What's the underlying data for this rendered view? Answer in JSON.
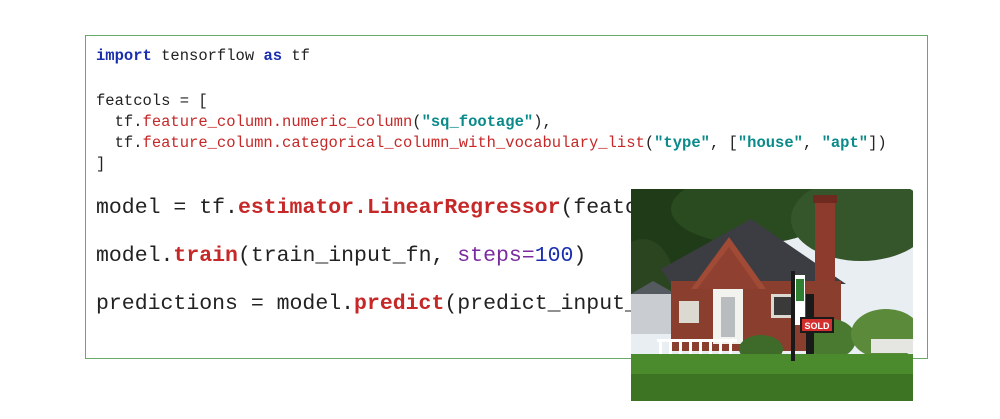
{
  "code": {
    "line1": {
      "kw_import": "import",
      "module": " tensorflow ",
      "kw_as": "as",
      "alias": " tf"
    },
    "line2": {
      "text": "featcols = ["
    },
    "line3": {
      "prefix": "  tf.",
      "fn": "feature_column.numeric_column",
      "open": "(",
      "str": "\"sq_footage\"",
      "close": "),"
    },
    "line4": {
      "prefix": "  tf.",
      "fn": "feature_column.categorical_column_with_vocabulary_list",
      "open": "(",
      "str1": "\"type\"",
      "sep1": ", [",
      "str2": "\"house\"",
      "sep2": ", ",
      "str3": "\"apt\"",
      "close": "])"
    },
    "line5": {
      "text": "]"
    },
    "line6": {
      "prefix": "model = tf.",
      "fn": "estimator.LinearRegressor",
      "suffix": "(featcols)"
    },
    "line7": {
      "prefix": "model.",
      "fn": "train",
      "mid": "(train_input_fn, ",
      "param": "steps=",
      "num": "100",
      "close": ")"
    },
    "line8": {
      "prefix": "predictions = model.",
      "fn": "predict",
      "suffix": "(predict_input_fn)"
    }
  },
  "photo": {
    "sign_text": "SOLD"
  },
  "colors": {
    "border": "#6aa86a",
    "keyword": "#1a2fb0",
    "function": "#c62828",
    "string": "#0a8a8a",
    "param": "#7a2ba0"
  }
}
